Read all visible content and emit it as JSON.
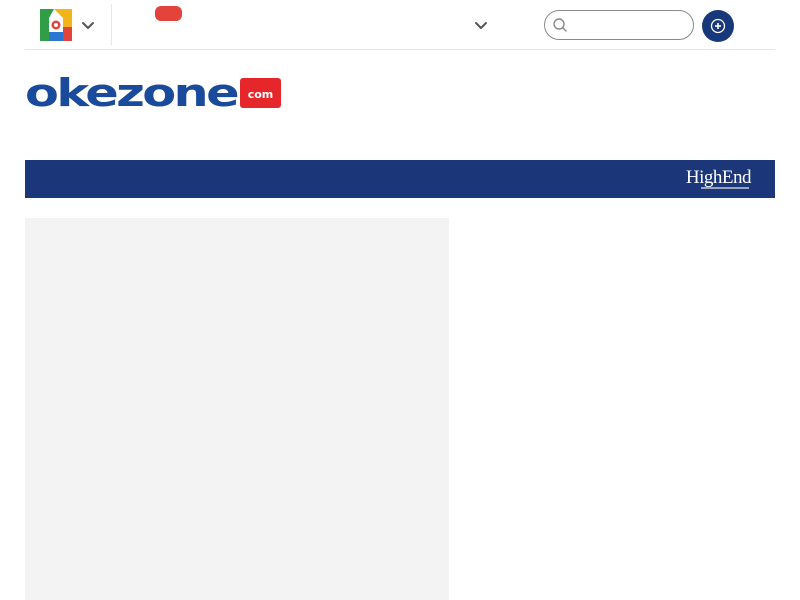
{
  "header": {
    "app_logo": "okezone-app-icon",
    "app_chevron": "chevron-down-icon",
    "channel_chevron": "chevron-down-icon",
    "live_badge_color": "#e2433b",
    "search": {
      "value": "",
      "placeholder": "",
      "icon": "search-icon"
    },
    "plus_button_icon": "plus-icon",
    "accent_color": "#17387a"
  },
  "brand": {
    "logo_text": "okezone",
    "logo_suffix": "com",
    "logo_blue": "#1a4a9c",
    "logo_red": "#e5262b"
  },
  "navbar": {
    "background": "#1b3779",
    "partner_logo_text": "HighEnd"
  },
  "content": {
    "ad_slot_color": "#f3f3f3"
  }
}
